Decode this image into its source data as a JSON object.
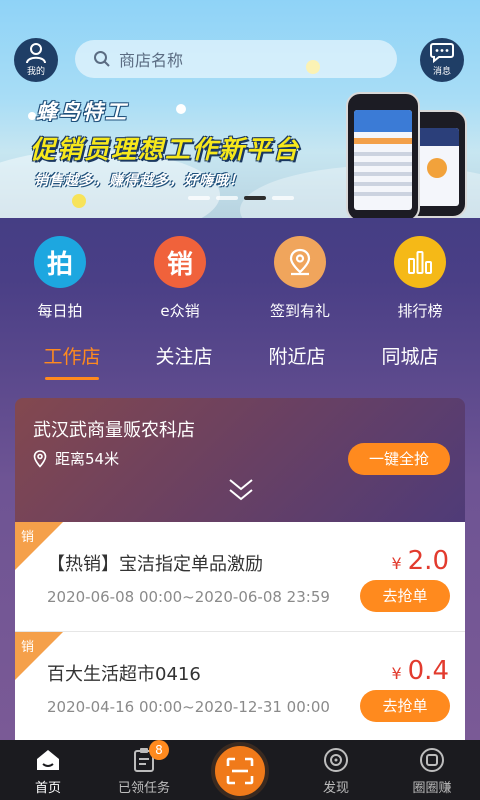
{
  "header": {
    "my_label": "我的",
    "search_placeholder": "商店名称",
    "message_label": "消息"
  },
  "banner": {
    "brand": "蜂鸟特工",
    "slogan": "促销员理想工作新平台",
    "subslogan": "销售越多，赚得越多，好嗨哦！",
    "active_page": 3,
    "page_count": 4
  },
  "quick_menu": [
    {
      "label": "每日拍",
      "glyph": "拍",
      "color": "#1da7e0",
      "icon": "camera-icon"
    },
    {
      "label": "e众销",
      "glyph": "销",
      "color": "#f0623b",
      "icon": "sales-icon"
    },
    {
      "label": "签到有礼",
      "glyph": "",
      "color": "#f0a55c",
      "icon": "location-pin-icon"
    },
    {
      "label": "排行榜",
      "glyph": "",
      "color": "#f5b917",
      "icon": "bar-chart-icon"
    }
  ],
  "tabs": [
    {
      "label": "工作店",
      "active": true
    },
    {
      "label": "关注店",
      "active": false
    },
    {
      "label": "附近店",
      "active": false
    },
    {
      "label": "同城店",
      "active": false
    }
  ],
  "store": {
    "name": "武汉武商量贩农科店",
    "distance": "距离54米",
    "grab_all_label": "一键全抢"
  },
  "items": [
    {
      "tag": "销",
      "title": "【热销】宝洁指定单品激励",
      "date": "2020-06-08 00:00~2020-06-08 23:59",
      "currency": "¥",
      "price": "2.0",
      "action": "去抢单"
    },
    {
      "tag": "销",
      "title": "百大生活超市0416",
      "date": "2020-04-16 00:00~2020-12-31 00:00",
      "currency": "¥",
      "price": "0.4",
      "action": "去抢单"
    }
  ],
  "bottom_nav": {
    "home": "首页",
    "tasks": "已领任务",
    "tasks_badge": "8",
    "discover": "发现",
    "earn": "圈圈赚"
  },
  "colors": {
    "accent": "#ff8a1e",
    "price": "#e23b2e",
    "nav_bg": "#1b1b1f"
  }
}
